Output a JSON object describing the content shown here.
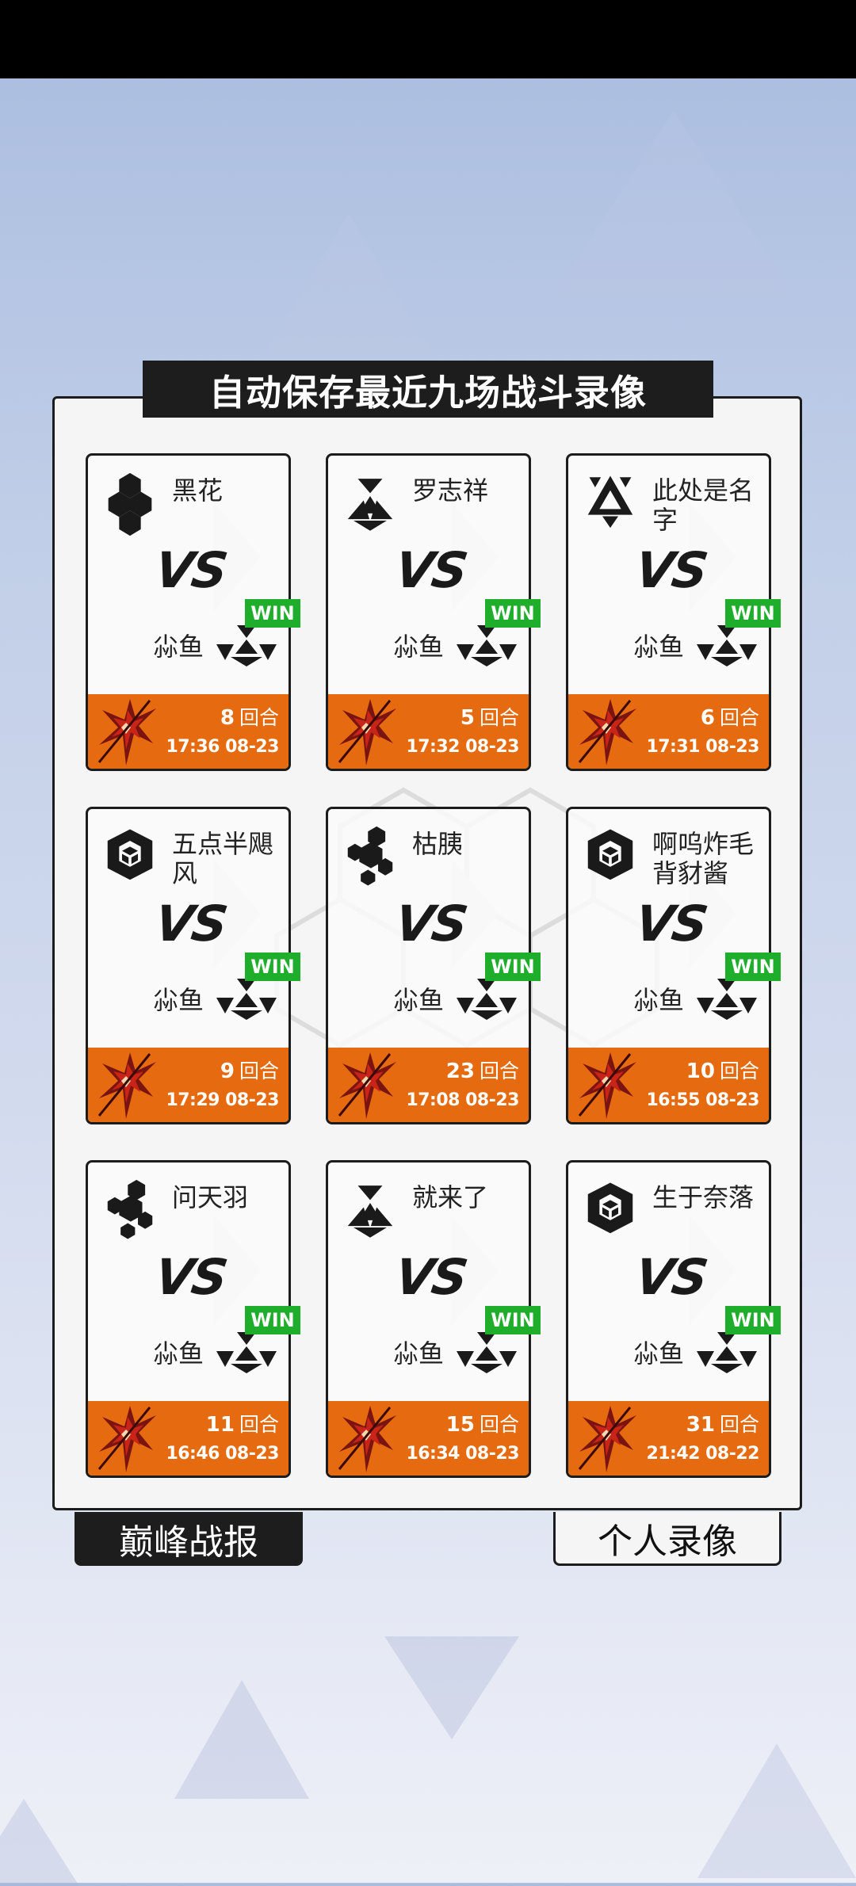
{
  "title": "自动保存最近九场战斗录像",
  "vs_label": "VS",
  "win_label": "WIN",
  "rounds_suffix": "回合",
  "self_name": "尛鱼",
  "tabs": {
    "left": "巅峰战报",
    "right": "个人录像"
  },
  "colors": {
    "footer": "#e66a10",
    "win": "#1fae2b",
    "dark": "#1d1d1d"
  },
  "matches": [
    {
      "opponent": "黑花",
      "opponent_icon": "hexagon-cluster-icon",
      "rounds": "8",
      "time": "17:36 08-23",
      "result": "WIN"
    },
    {
      "opponent": "罗志祥",
      "opponent_icon": "triangle-trio-icon",
      "rounds": "5",
      "time": "17:32 08-23",
      "result": "WIN"
    },
    {
      "opponent": "此处是名字",
      "opponent_icon": "triangle-emblem-icon",
      "rounds": "6",
      "time": "17:31 08-23",
      "result": "WIN"
    },
    {
      "opponent": "五点半飓风",
      "opponent_icon": "cube-icon",
      "rounds": "9",
      "time": "17:29 08-23",
      "result": "WIN"
    },
    {
      "opponent": "枯胰",
      "opponent_icon": "hex-dots-icon",
      "rounds": "23",
      "time": "17:08 08-23",
      "result": "WIN"
    },
    {
      "opponent": "啊呜炸毛背豺酱",
      "opponent_icon": "cube-icon",
      "rounds": "10",
      "time": "16:55 08-23",
      "result": "WIN"
    },
    {
      "opponent": "问天羽",
      "opponent_icon": "hex-dots-icon",
      "rounds": "11",
      "time": "16:46 08-23",
      "result": "WIN"
    },
    {
      "opponent": "就来了",
      "opponent_icon": "triangle-trio-icon",
      "rounds": "15",
      "time": "16:34 08-23",
      "result": "WIN"
    },
    {
      "opponent": "生于奈落",
      "opponent_icon": "cube-icon",
      "rounds": "31",
      "time": "21:42 08-22",
      "result": "WIN"
    }
  ]
}
